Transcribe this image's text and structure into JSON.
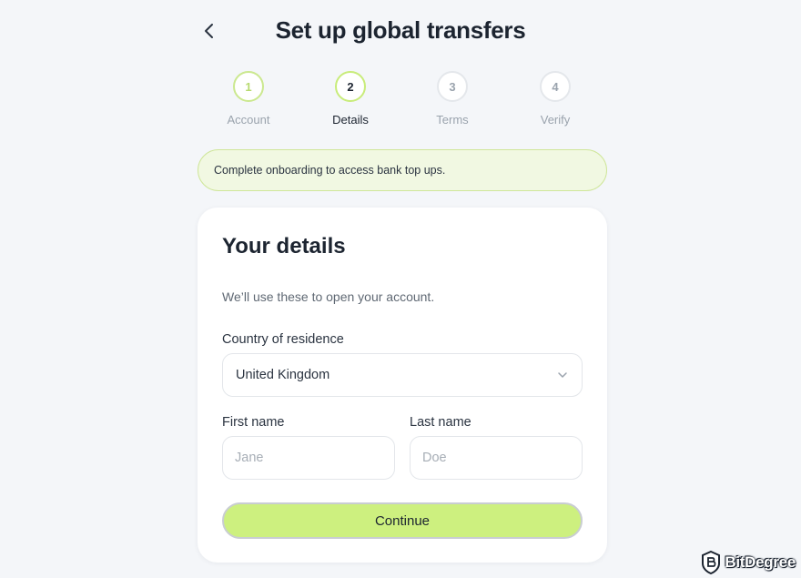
{
  "header": {
    "title": "Set up global transfers"
  },
  "stepper": {
    "steps": [
      {
        "number": "1",
        "label": "Account",
        "state": "done"
      },
      {
        "number": "2",
        "label": "Details",
        "state": "active"
      },
      {
        "number": "3",
        "label": "Terms",
        "state": "upcoming"
      },
      {
        "number": "4",
        "label": "Verify",
        "state": "upcoming"
      }
    ]
  },
  "notice": {
    "text": "Complete onboarding to access bank top ups."
  },
  "form": {
    "title": "Your details",
    "subtitle": "We’ll use these to open your account.",
    "country": {
      "label": "Country of residence",
      "value": "United Kingdom"
    },
    "first_name": {
      "label": "First name",
      "placeholder": "Jane",
      "value": ""
    },
    "last_name": {
      "label": "Last name",
      "placeholder": "Doe",
      "value": ""
    },
    "continue_label": "Continue"
  },
  "watermark": {
    "text": "BitDegree"
  },
  "colors": {
    "accent": "#cdf07f",
    "notice_bg": "#f1f8e2",
    "page_bg": "#f4f6f9"
  },
  "icons": {
    "back": "chevron-left-icon",
    "select": "chevron-down-icon",
    "watermark": "bitdegree-logo-icon"
  }
}
